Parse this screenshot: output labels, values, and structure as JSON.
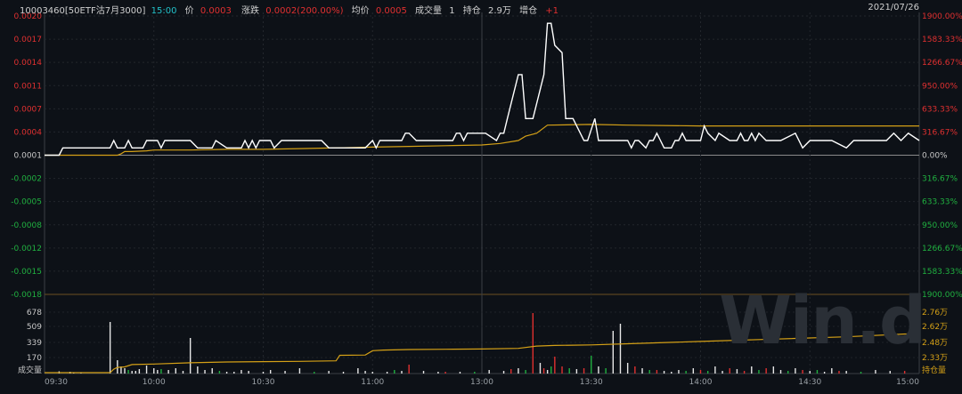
{
  "header": {
    "code_name": "10003460[50ETF沽7月3000]",
    "time": "15:00",
    "price_label": "价",
    "price": "0.0003",
    "change_label": "涨跌",
    "change": "0.0002(200.00%)",
    "avg_label": "均价",
    "avg": "0.0005",
    "volume_label": "成交量",
    "volume": "1",
    "oi_label": "持仓",
    "oi": "2.9万",
    "oi_change_label": "增仓",
    "oi_change": "+1",
    "date": "2021/07/26"
  },
  "watermark": "Win.d",
  "colors": {
    "background": "#0d1117",
    "price_line": "#ffffff",
    "avg_line": "#d4a017",
    "up": "#e03030",
    "down": "#20b040",
    "grid": "#4a3a1a"
  },
  "chart_data": [
    {
      "type": "line",
      "title": "",
      "x_ticks": [
        "09:30",
        "10:00",
        "10:30",
        "11:00",
        "13:00",
        "13:30",
        "14:00",
        "14:30",
        "15:00"
      ],
      "y_ticks_left": [
        "0.0020",
        "0.0017",
        "0.0014",
        "0.0011",
        "0.0007",
        "0.0004",
        "0.0001",
        "-0.0002",
        "-0.0005",
        "-0.0008",
        "-0.0012",
        "-0.0015",
        "-0.0018"
      ],
      "y_ticks_right": [
        "1900.00%",
        "1583.33%",
        "1266.67%",
        "950.00%",
        "633.33%",
        "316.67%",
        "0.00%",
        "316.67%",
        "633.33%",
        "950.00%",
        "1266.67%",
        "1583.33%",
        "1900.00%"
      ],
      "ylim": [
        -0.0018,
        0.002
      ],
      "series": [
        {
          "name": "价",
          "x": [
            0,
            4,
            5,
            6,
            18,
            19,
            20,
            22,
            23,
            24,
            25,
            27,
            28,
            31,
            32,
            33,
            40,
            42,
            46,
            47,
            50,
            54,
            55,
            56,
            57,
            58,
            59,
            62,
            63,
            65,
            76,
            78,
            88,
            90,
            91,
            92,
            98,
            99,
            100,
            102,
            106,
            111,
            112,
            113,
            114,
            115,
            116,
            117,
            118,
            119,
            120,
            121,
            124,
            125,
            126,
            127,
            128,
            130,
            131,
            132,
            134,
            137,
            138,
            139,
            140,
            142,
            143,
            145,
            148,
            149,
            151,
            152,
            153,
            160,
            161,
            162,
            163,
            165,
            166,
            167,
            168,
            170,
            172,
            173,
            174,
            175,
            176,
            180,
            181,
            182,
            184,
            185,
            188,
            190,
            191,
            192,
            193,
            194,
            195,
            196,
            198,
            200,
            202,
            206,
            208,
            210,
            212,
            214,
            216,
            220,
            222,
            225,
            228,
            231,
            233,
            235,
            237,
            240,
            240
          ],
          "y": [
            0.0001,
            0.0001,
            0.0002,
            0.0002,
            0.0002,
            0.0003,
            0.0002,
            0.0002,
            0.0003,
            0.0002,
            0.0002,
            0.0002,
            0.0003,
            0.0003,
            0.0002,
            0.0003,
            0.0003,
            0.0002,
            0.0002,
            0.0003,
            0.0002,
            0.0002,
            0.0003,
            0.0002,
            0.0003,
            0.0002,
            0.0003,
            0.0003,
            0.0002,
            0.0003,
            0.0003,
            0.0002,
            0.0002,
            0.0003,
            0.0002,
            0.0003,
            0.0003,
            0.0004,
            0.0004,
            0.0003,
            0.0003,
            0.0003,
            0.0003,
            0.0004,
            0.0004,
            0.0003,
            0.0004,
            0.0004,
            0.0004,
            0.0004,
            0.0004,
            0.0004,
            0.0003,
            0.0004,
            0.0004,
            0.0006,
            0.0008,
            0.0012,
            0.0012,
            0.0006,
            0.0006,
            0.0012,
            0.0019,
            0.0019,
            0.0016,
            0.0015,
            0.0006,
            0.0006,
            0.0003,
            0.0003,
            0.0006,
            0.0003,
            0.0003,
            0.0003,
            0.0002,
            0.0003,
            0.0003,
            0.0002,
            0.0003,
            0.0003,
            0.0004,
            0.0002,
            0.0002,
            0.0003,
            0.0003,
            0.0004,
            0.0003,
            0.0003,
            0.0005,
            0.0004,
            0.0003,
            0.0004,
            0.0003,
            0.0003,
            0.0004,
            0.0003,
            0.0003,
            0.0004,
            0.0003,
            0.0004,
            0.0003,
            0.0003,
            0.0003,
            0.0004,
            0.0002,
            0.0003,
            0.0003,
            0.0003,
            0.0003,
            0.0002,
            0.0003,
            0.0003,
            0.0003,
            0.0003,
            0.0004,
            0.0003,
            0.0004,
            0.0003,
            0.0003
          ]
        },
        {
          "name": "均价",
          "x": [
            0,
            10,
            20,
            21,
            22,
            24,
            28,
            30,
            40,
            50,
            60,
            70,
            90,
            100,
            110,
            120,
            125,
            130,
            132,
            135,
            138,
            150,
            160,
            180,
            200,
            220,
            240
          ],
          "y": [
            0.0001,
            0.0001,
            0.0001,
            0.00012,
            0.00015,
            0.00015,
            0.00016,
            0.00017,
            0.00017,
            0.00018,
            0.00018,
            0.00019,
            0.00021,
            0.00022,
            0.00023,
            0.00024,
            0.00026,
            0.0003,
            0.00036,
            0.0004,
            0.00051,
            0.00052,
            0.00051,
            0.0005,
            0.0005,
            0.0005,
            0.0005
          ]
        }
      ]
    },
    {
      "type": "bar",
      "title": "",
      "y_ticks_left": [
        "678",
        "509",
        "339",
        "170",
        "成交量"
      ],
      "y_ticks_right": [
        "2.76万",
        "2.62万",
        "2.48万",
        "2.33万",
        "持仓量"
      ],
      "ylim": [
        0,
        800
      ],
      "volume": {
        "x": [
          4,
          7,
          8,
          10,
          18,
          20,
          21,
          22,
          23,
          24,
          25,
          26,
          28,
          30,
          31,
          32,
          34,
          36,
          38,
          40,
          42,
          44,
          46,
          48,
          50,
          52,
          54,
          56,
          60,
          62,
          66,
          70,
          74,
          78,
          82,
          86,
          88,
          90,
          94,
          96,
          98,
          100,
          104,
          108,
          110,
          114,
          118,
          122,
          126,
          128,
          130,
          132,
          134,
          136,
          137,
          138,
          139,
          140,
          142,
          144,
          146,
          148,
          150,
          152,
          154,
          156,
          158,
          160,
          162,
          164,
          166,
          168,
          170,
          172,
          174,
          176,
          178,
          180,
          182,
          184,
          186,
          188,
          190,
          192,
          194,
          196,
          198,
          200,
          202,
          204,
          206,
          208,
          210,
          212,
          214,
          216,
          218,
          220,
          224,
          228,
          232,
          236
        ],
        "values": [
          25,
          20,
          10,
          10,
          580,
          150,
          80,
          60,
          40,
          30,
          30,
          50,
          90,
          60,
          40,
          50,
          40,
          60,
          30,
          400,
          80,
          40,
          60,
          30,
          20,
          20,
          40,
          30,
          20,
          40,
          30,
          60,
          20,
          30,
          20,
          60,
          30,
          20,
          20,
          40,
          30,
          100,
          30,
          20,
          20,
          20,
          20,
          40,
          30,
          50,
          60,
          40,
          680,
          120,
          60,
          40,
          80,
          190,
          80,
          60,
          50,
          60,
          200,
          80,
          60,
          480,
          560,
          120,
          80,
          60,
          40,
          40,
          30,
          20,
          40,
          30,
          60,
          40,
          30,
          80,
          30,
          60,
          50,
          30,
          80,
          40,
          60,
          80,
          40,
          30,
          60,
          40,
          30,
          40,
          20,
          60,
          30,
          30,
          20,
          40,
          30,
          30
        ],
        "colors": [
          "w",
          "w",
          "w",
          "w",
          "w",
          "w",
          "w",
          "w",
          "g",
          "w",
          "w",
          "w",
          "w",
          "w",
          "w",
          "g",
          "w",
          "w",
          "w",
          "w",
          "w",
          "w",
          "w",
          "g",
          "w",
          "w",
          "w",
          "w",
          "w",
          "w",
          "w",
          "w",
          "g",
          "w",
          "w",
          "w",
          "w",
          "w",
          "w",
          "g",
          "w",
          "r",
          "w",
          "w",
          "r",
          "w",
          "g",
          "w",
          "w",
          "r",
          "w",
          "g",
          "r",
          "w",
          "r",
          "w",
          "g",
          "r",
          "r",
          "g",
          "w",
          "r",
          "g",
          "w",
          "g",
          "w",
          "w",
          "w",
          "r",
          "w",
          "g",
          "r",
          "w",
          "w",
          "w",
          "g",
          "w",
          "r",
          "g",
          "w",
          "w",
          "r",
          "w",
          "r",
          "w",
          "g",
          "r",
          "w",
          "w",
          "g",
          "w",
          "r",
          "w",
          "g",
          "w",
          "w",
          "r",
          "w",
          "g",
          "w",
          "w",
          "r"
        ]
      },
      "open_interest": {
        "name": "持仓量",
        "x": [
          0,
          18,
          19,
          20,
          22,
          24,
          30,
          40,
          50,
          60,
          70,
          80,
          81,
          88,
          90,
          93,
          100,
          110,
          120,
          130,
          135,
          140,
          145,
          150,
          160,
          180,
          200,
          220,
          240
        ],
        "y": [
          0,
          0,
          60,
          90,
          100,
          140,
          150,
          170,
          185,
          190,
          195,
          205,
          300,
          305,
          380,
          390,
          400,
          405,
          410,
          420,
          460,
          470,
          475,
          480,
          500,
          540,
          580,
          620,
          680
        ]
      }
    }
  ]
}
